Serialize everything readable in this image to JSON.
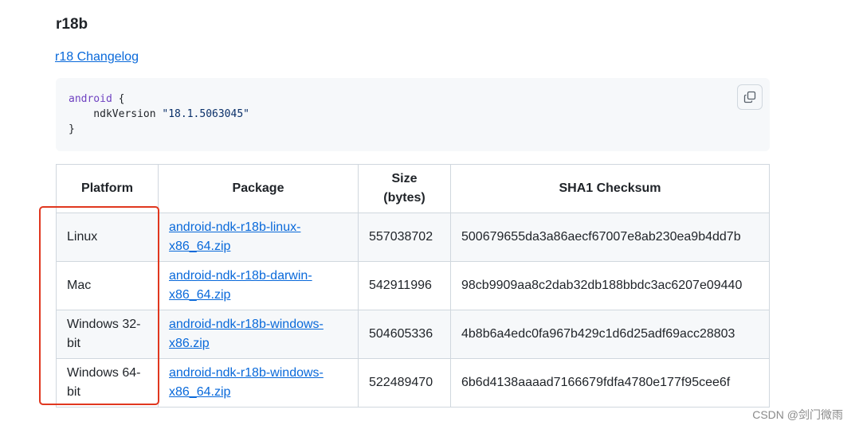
{
  "section": {
    "heading": "r18b",
    "changelog_link": "r18 Changelog"
  },
  "code": {
    "line1_keyword": "android",
    "line1_rest": " {",
    "line2_indent": "    ndkVersion ",
    "line2_string": "\"18.1.5063045\"",
    "line3": "}"
  },
  "copy_button": {
    "icon": "copy-icon"
  },
  "table": {
    "headers": {
      "platform": "Platform",
      "package": "Package",
      "size_line1": "Size",
      "size_line2": "(bytes)",
      "checksum": "SHA1 Checksum"
    },
    "rows": [
      {
        "platform": "Linux",
        "package_line1": "android-ndk-r18b-linux-",
        "package_line2": "x86_64.zip",
        "size": "557038702",
        "checksum": "500679655da3a86aecf67007e8ab230ea9b4dd7b"
      },
      {
        "platform": "Mac",
        "package_line1": "android-ndk-r18b-darwin-",
        "package_line2": "x86_64.zip",
        "size": "542911996",
        "checksum": "98cb9909aa8c2dab32db188bbdc3ac6207e09440"
      },
      {
        "platform_line1": "Windows 32-",
        "platform_line2": "bit",
        "package_line1": "android-ndk-r18b-windows-",
        "package_line2": "x86.zip",
        "size": "504605336",
        "checksum": "4b8b6a4edc0fa967b429c1d6d25adf69acc28803"
      },
      {
        "platform_line1": "Windows 64-",
        "platform_line2": "bit",
        "package_line1": "android-ndk-r18b-windows-",
        "package_line2": "x86_64.zip",
        "size": "522489470",
        "checksum": "6b6d4138aaaad7166679fdfa4780e177f95cee6f"
      }
    ]
  },
  "annotation": {
    "highlight_color": "#e0371f"
  },
  "watermark": "CSDN @剑门微雨",
  "colors": {
    "link": "#0969da",
    "code_bg": "#f6f8fa",
    "border": "#d0d7de"
  }
}
